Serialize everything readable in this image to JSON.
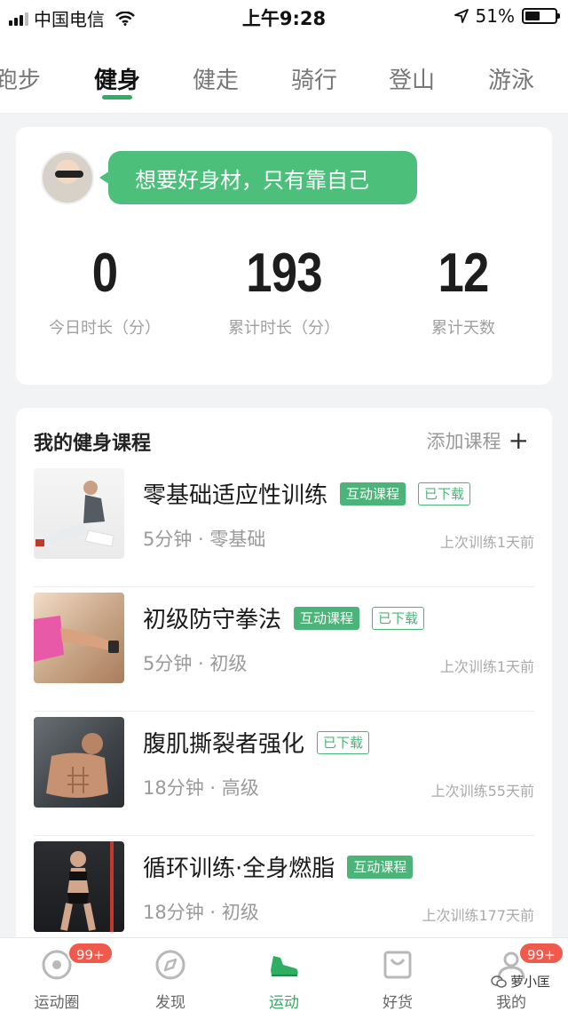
{
  "status_bar": {
    "carrier": "中国电信",
    "time": "上午9:28",
    "battery": "51%",
    "battery_level": 0.51
  },
  "category_tabs": [
    {
      "label": "跑步",
      "active": false
    },
    {
      "label": "健身",
      "active": true
    },
    {
      "label": "健走",
      "active": false
    },
    {
      "label": "骑行",
      "active": false
    },
    {
      "label": "登山",
      "active": false
    },
    {
      "label": "游泳",
      "active": false
    }
  ],
  "stats_card": {
    "motto": "想要好身材，只有靠自己",
    "stats": [
      {
        "value": "0",
        "label": "今日时长（分）"
      },
      {
        "value": "193",
        "label": "累计时长（分）"
      },
      {
        "value": "12",
        "label": "累计天数"
      }
    ]
  },
  "courses": {
    "title": "我的健身课程",
    "add_label": "添加课程",
    "items": [
      {
        "name": "零基础适应性训练",
        "tags": [
          "互动课程",
          "已下载"
        ],
        "meta": "5分钟 · 零基础",
        "last": "上次训练1天前"
      },
      {
        "name": "初级防守拳法",
        "tags": [
          "互动课程",
          "已下载"
        ],
        "meta": "5分钟 · 初级",
        "last": "上次训练1天前"
      },
      {
        "name": "腹肌撕裂者强化",
        "tags": [
          "已下载"
        ],
        "meta": "18分钟 · 高级",
        "last": "上次训练55天前"
      },
      {
        "name": "循环训练·全身燃脂",
        "tags": [
          "互动课程"
        ],
        "meta": "18分钟 · 初级",
        "last": "上次训练177天前"
      }
    ]
  },
  "bottom_nav": [
    {
      "label": "运动圈",
      "icon": "circle-dot-icon",
      "badge": "99+"
    },
    {
      "label": "发现",
      "icon": "compass-icon"
    },
    {
      "label": "运动",
      "icon": "shoe-icon",
      "active": true
    },
    {
      "label": "好货",
      "icon": "shopping-bag-icon"
    },
    {
      "label": "我的",
      "icon": "person-icon",
      "badge": "99+"
    }
  ],
  "watermark": "萝小匡",
  "colors": {
    "accent": "#2fae63",
    "bubble": "#4cbf7b",
    "badge": "#ef5a4d"
  }
}
